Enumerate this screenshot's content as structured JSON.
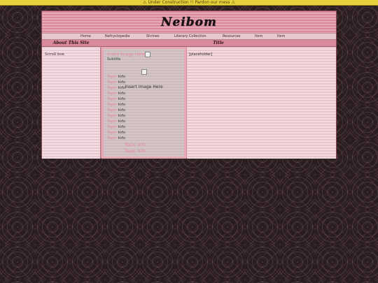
{
  "banner": {
    "text": "⚠ Under Construction !! Pardon our mess ⚠"
  },
  "header": {
    "logo_text": "Neibom"
  },
  "nav": {
    "items": [
      "Home",
      "Nefcyclopedia",
      "Shrines",
      "Literary Collection",
      "Resources",
      "Item",
      "Item"
    ]
  },
  "left": {
    "title": "About This Site",
    "scroll_text": "Scroll box"
  },
  "right": {
    "title": "Title",
    "placeholder": "[placeholder]"
  },
  "inner": {
    "image1": "Insert Image Here",
    "subtitle": "Subtitle",
    "image2": "Insert Image Here",
    "topics": [
      {
        "key": "Topic",
        "val": "Info"
      },
      {
        "key": "Topic",
        "val": "Info"
      },
      {
        "key": "Topic",
        "val": "Info"
      },
      {
        "key": "Topic",
        "val": "Info"
      },
      {
        "key": "Topic",
        "val": "Info"
      },
      {
        "key": "Topic",
        "val": "Info"
      },
      {
        "key": "Topic",
        "val": "Info"
      },
      {
        "key": "Topic",
        "val": "Info"
      },
      {
        "key": "Topic",
        "val": "Info"
      },
      {
        "key": "Topic",
        "val": "Info"
      },
      {
        "key": "Topic",
        "val": "Info"
      },
      {
        "key": "Topic",
        "val": "Info"
      }
    ],
    "topics_wide": [
      {
        "key": "Topic",
        "val": "Info"
      },
      {
        "key": "Topic",
        "val": "Info"
      }
    ]
  }
}
